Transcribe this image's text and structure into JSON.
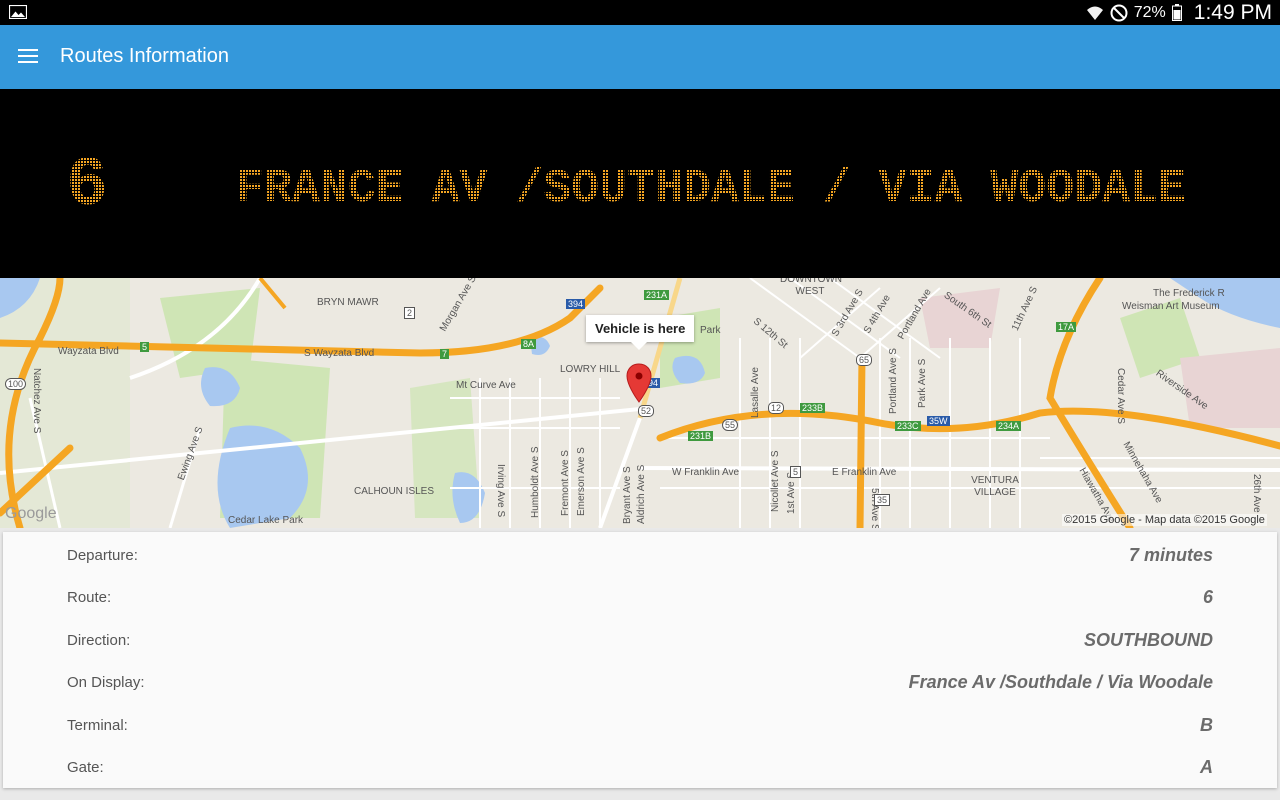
{
  "status_bar": {
    "battery": "72%",
    "time": "1:49 PM",
    "icons": [
      "gallery-icon",
      "wifi-icon",
      "do-not-disturb-icon",
      "battery-icon"
    ]
  },
  "app_bar": {
    "title": "Routes Information",
    "menu_icon": "menu-icon",
    "color": "#3498db"
  },
  "led_display": {
    "route_number": "6",
    "destination": "FRANCE AV /SOUTHDALE / VIA WOODALE",
    "led_color": "#f5a623"
  },
  "map": {
    "callout": "Vehicle is here",
    "google_logo": "Google",
    "attribution": "©2015 Google - Map data ©2015 Google",
    "labels": {
      "bryn_mawr": "BRYN MAWR",
      "downtown_west": "DOWNTOWN WEST",
      "frederick": "The Frederick R",
      "weisman": "Weisman Art Museum",
      "wayzata_blvd": "Wayzata Blvd",
      "s_wayzata_blvd": "S Wayzata Blvd",
      "mt_curve": "Mt Curve Ave",
      "lowry_hill": "LOWRY HILL",
      "park": "Park",
      "calhoun_isles": "CALHOUN ISLES",
      "cedar_lake_park": "Cedar Lake Park",
      "w_franklin": "W Franklin Ave",
      "e_franklin": "E Franklin Ave",
      "ventura_village": "VENTURA VILLAGE",
      "natchez": "Natchez Ave S",
      "ewing": "Ewing Ave S",
      "morgan": "Morgan Ave S",
      "irving": "Irving Ave S",
      "humboldt": "Humboldt Ave S",
      "fremont": "Fremont Ave S",
      "emerson": "Emerson Ave S",
      "bryant": "Bryant Ave S",
      "aldrich": "Aldrich Ave S",
      "lasalle": "Lasalle Ave",
      "nicollet": "Nicollet Ave S",
      "first_ave": "1st Ave S",
      "portland": "Portland Ave S",
      "park_ave": "Park Ave S",
      "fifth_ave": "5th Ave S",
      "s_12th": "S 12th St",
      "s_3rd": "S 3rd Ave S",
      "s_4th": "S 4th Ave",
      "portland_ne": "Portland Ave",
      "s_6th": "South 6th St",
      "eleventh": "11th Ave S",
      "cedar": "Cedar Ave S",
      "riverside": "Riverside Ave",
      "minnehaha": "Minnehaha Ave",
      "hiawatha": "Hiawatha Ave",
      "twentysixth": "26th Ave"
    },
    "shields": [
      "2",
      "394",
      "231A",
      "5",
      "7",
      "8A",
      "100",
      "94",
      "52",
      "65",
      "12",
      "55",
      "233B",
      "231B",
      "233C",
      "35W",
      "234A",
      "17A",
      "5",
      "35"
    ]
  },
  "details": [
    {
      "label": "Departure:",
      "value": "7 minutes"
    },
    {
      "label": "Route:",
      "value": "6"
    },
    {
      "label": "Direction:",
      "value": "SOUTHBOUND"
    },
    {
      "label": "On Display:",
      "value": "France Av /Southdale / Via Woodale"
    },
    {
      "label": "Terminal:",
      "value": "B"
    },
    {
      "label": "Gate:",
      "value": "A"
    }
  ]
}
